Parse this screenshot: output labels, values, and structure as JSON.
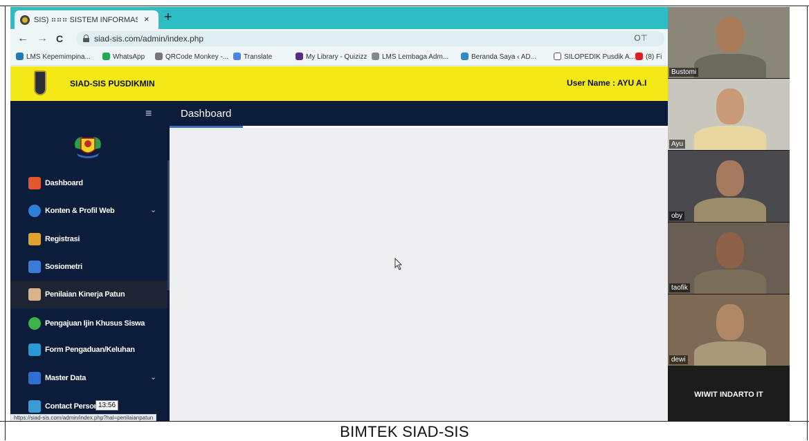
{
  "browser": {
    "tab_title": "SIS) ⠶⠶⠶ SISTEM INFORMASI AD",
    "tab_close": "×",
    "new_tab": "+",
    "back": "←",
    "forward": "→",
    "reload": "C",
    "url": "siad-sis.com/admin/index.php",
    "key_icon": "O⊤",
    "bookmarks": [
      {
        "label": "LMS Kepemimpina...",
        "color": "#1f7ab8"
      },
      {
        "label": "WhatsApp",
        "color": "#25a75a"
      },
      {
        "label": "QRCode Monkey -...",
        "color": "#777777"
      },
      {
        "label": "Translate",
        "color": "#4a86e8"
      },
      {
        "label": "My Library - Quizizz",
        "color": "#5a2a8a"
      },
      {
        "label": "LMS Lembaga Adm...",
        "color": "#888888"
      },
      {
        "label": "Beranda Saya ‹ AD...",
        "color": "#2d8ac5"
      },
      {
        "label": "SILOPEDIK Pusdik A...",
        "color": "#ffffff"
      },
      {
        "label": "(8) Fi",
        "color": "#e02020"
      }
    ],
    "status_url": "https://siad-sis.com/admin/index.php?hal=penilaianpatun"
  },
  "app": {
    "title": "SIAD-SIS PUSDIKMIN",
    "user_label": "User Name : AYU A.I",
    "menu_toggle": "≡",
    "content_title": "Dashboard",
    "menu": [
      {
        "label": "Dashboard",
        "icon": "home-icon",
        "color": "#e4572e",
        "chevron": ""
      },
      {
        "label": "Konten & Profil Web",
        "icon": "www-globe-icon",
        "color": "#2f7fd8",
        "chevron": "⌄"
      },
      {
        "label": "Registrasi",
        "icon": "user-icon",
        "color": "#e0a32a",
        "chevron": ""
      },
      {
        "label": "Sosiometri",
        "icon": "group-icon",
        "color": "#3a7bd5",
        "chevron": ""
      },
      {
        "label": "Penilaian Kinerja Patun",
        "icon": "clipboard-icon",
        "color": "#d9b38c",
        "chevron": ""
      },
      {
        "label": "Pengajuan Ijin Khusus Siswa",
        "icon": "check-icon",
        "color": "#3bb34a",
        "chevron": ""
      },
      {
        "label": "Form Pengaduan/Keluhan",
        "icon": "form-icon",
        "color": "#2a9ad6",
        "chevron": ""
      },
      {
        "label": "Master Data",
        "icon": "database-icon",
        "color": "#2f6fd1",
        "chevron": "⌄"
      },
      {
        "label": "Contact Person",
        "icon": "phone-icon",
        "color": "#3a9bd5",
        "chevron": ""
      }
    ]
  },
  "timer": "13:56",
  "participants": [
    {
      "name": "Bustomi",
      "bg": "#8a8778",
      "skin": "#a87a5a",
      "uniform": "#6b6b5c"
    },
    {
      "name": "Ayu",
      "bg": "#c9c6be",
      "skin": "#c89a78",
      "uniform": "#e8d8a0"
    },
    {
      "name": "oby",
      "bg": "#4a4a4e",
      "skin": "#a67a5e",
      "uniform": "#9a8d6a"
    },
    {
      "name": "taofik",
      "bg": "#6a5e52",
      "skin": "#8d6248",
      "uniform": "#7a6e5a"
    },
    {
      "name": "dewi",
      "bg": "#7e6a54",
      "skin": "#b08866",
      "uniform": "#a89a78"
    }
  ],
  "presenter": "WIWIT INDARTO IT",
  "caption": "BIMTEK SIAD-SIS"
}
